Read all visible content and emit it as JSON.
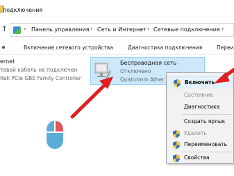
{
  "window": {
    "title": "подключения"
  },
  "address": {
    "up_arrow": "↑",
    "crumbs": [
      "Панель управления",
      "Сеть и Интернет",
      "Сетевые подключения"
    ],
    "separator": "›"
  },
  "toolbar": {
    "items": [
      "Включение сетевого устройства",
      "Диагностика подключения",
      "Переи"
    ]
  },
  "connections": {
    "ethernet": {
      "name": "ernet",
      "status": "тевой кабель не подключен",
      "adapter": "ltek PCIe GBE Family Controller"
    },
    "wireless": {
      "name": "Беспроводная сеть",
      "status": "Отключено",
      "adapter": "Qualcomm Ather"
    }
  },
  "context_menu": {
    "items": [
      {
        "label": "Включить",
        "icon": "shield-icon",
        "default": true,
        "enabled": true
      },
      {
        "label": "Состояние",
        "icon": "",
        "default": false,
        "enabled": false
      },
      {
        "label": "Диагностика",
        "icon": "",
        "default": false,
        "enabled": true
      },
      {
        "label": "Создать ярлык",
        "icon": "",
        "default": false,
        "enabled": true
      },
      {
        "label": "Удалить",
        "icon": "shield-icon",
        "default": false,
        "enabled": false
      },
      {
        "label": "Переименовать",
        "icon": "shield-icon",
        "default": false,
        "enabled": true
      },
      {
        "label": "Свойства",
        "icon": "shield-icon",
        "default": false,
        "enabled": true
      }
    ]
  },
  "colors": {
    "selection_fill": "#cde8fb",
    "annotation_arrow": "#e02020",
    "mouse_body": "#5aaed6",
    "mouse_button": "#e25757"
  }
}
